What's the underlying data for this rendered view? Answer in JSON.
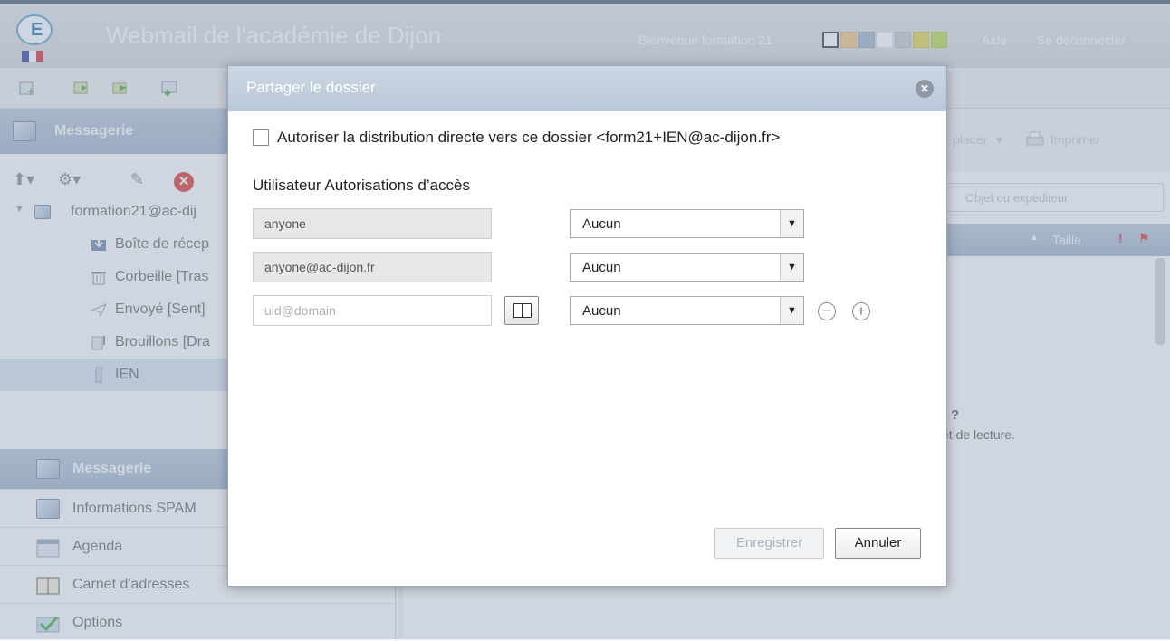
{
  "header": {
    "title": "Webmail de l'académie de Dijon",
    "welcome": "Bienvenue formation 21",
    "help_link": "Aide",
    "logout_link": "Se déconnecter",
    "theme_swatches": [
      "#ffffff",
      "#f6c77b",
      "#c9d7e8",
      "#ffffff",
      "#c8c8c8",
      "#e9d34a",
      "#b9dd4e"
    ]
  },
  "sidebar": {
    "section_title": "Messagerie",
    "account": "formation21@ac-dij",
    "folders": [
      {
        "label": "Boîte de récep",
        "icon": "inbox-icon"
      },
      {
        "label": "Corbeille [Tras",
        "icon": "trash-icon"
      },
      {
        "label": "Envoyé [Sent]",
        "icon": "sent-icon"
      },
      {
        "label": "Brouillons [Dra",
        "icon": "drafts-icon"
      },
      {
        "label": "IEN",
        "icon": "folder-icon"
      }
    ],
    "nav": [
      {
        "label": "Messagerie"
      },
      {
        "label": "Informations SPAM"
      },
      {
        "label": "Agenda"
      },
      {
        "label": "Carnet d'adresses"
      },
      {
        "label": "Options"
      }
    ]
  },
  "right_panel": {
    "move_label": "placer",
    "print_label": "Imprimer",
    "search_placeholder": "Objet ou expéditeur",
    "size_column": "Taille",
    "preview_question": "?",
    "preview_text": "et de lecture."
  },
  "dialog": {
    "title": "Partager le dossier",
    "checkbox_label": "Autoriser la distribution directe vers ce dossier <form21+IEN@ac-dijon.fr>",
    "acl_heading": "Utilisateur Autorisations d’accès",
    "rows": [
      {
        "user": "anyone",
        "permission": "Aucun"
      },
      {
        "user": "anyone@ac-dijon.fr",
        "permission": "Aucun"
      }
    ],
    "new_user_placeholder": "uid@domain",
    "new_permission": "Aucun",
    "save_label": "Enregistrer",
    "cancel_label": "Annuler"
  }
}
